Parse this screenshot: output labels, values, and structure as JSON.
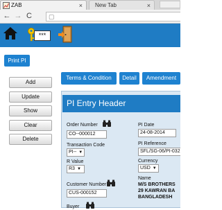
{
  "browser": {
    "tabs": [
      {
        "title": "ZAB",
        "close": "×"
      },
      {
        "title": "New Tab",
        "close": "×"
      }
    ],
    "nav": {
      "back": "←",
      "forward": "→",
      "reload": "C",
      "page": "▢"
    }
  },
  "header": {
    "password_mask": "***"
  },
  "actions": {
    "print_pi": "Print PI"
  },
  "sidebar": {
    "buttons": [
      {
        "label": "Add"
      },
      {
        "label": "Update"
      },
      {
        "label": "Show"
      },
      {
        "label": "Clear"
      },
      {
        "label": "Delete"
      }
    ]
  },
  "tabs": [
    {
      "label": "Terms & Condition"
    },
    {
      "label": "Detail"
    },
    {
      "label": "Amendment"
    }
  ],
  "panel": {
    "title": "PI Entry Header",
    "order_number": {
      "label": "Order Number",
      "value": "CO--000012"
    },
    "transaction_code": {
      "label": "Transaction Code",
      "value": "PI--"
    },
    "r_value": {
      "label": "R Value",
      "value": "R3"
    },
    "customer_number": {
      "label": "Customer Number",
      "value": "CUS-000152"
    },
    "buyer": {
      "label": "Buyer"
    },
    "pi_date": {
      "label": "PI Date",
      "value": "24-08-2014"
    },
    "pi_reference": {
      "label": "PI Reference",
      "value": "SFL/SG-06/PI-032"
    },
    "currency": {
      "label": "Currency",
      "value": "USD"
    },
    "name": {
      "label": "Name",
      "lines": [
        "M/S BROTHERS",
        "29 KAWRAN BA",
        "BANGLADESH"
      ]
    }
  },
  "colors": {
    "brand_blue": "#1f7cc4",
    "button_blue": "#1e82d0",
    "panel_bg": "#dbe8f3"
  }
}
